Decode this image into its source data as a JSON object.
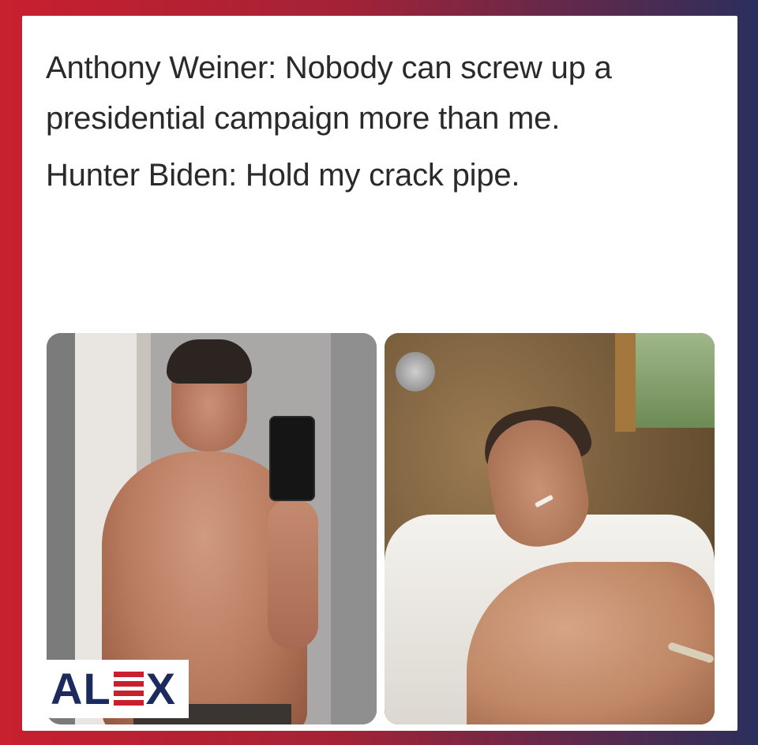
{
  "caption": {
    "line1": "Anthony Weiner: Nobody can screw up a presidential campaign more than me.",
    "line2": "Hunter Biden: Hold my crack pipe."
  },
  "logo": {
    "prefix": "AL",
    "suffix": "X"
  },
  "colors": {
    "frame_left": "#c8202f",
    "frame_right": "#2b2f5c",
    "logo_blue": "#1c2a5e",
    "logo_red": "#c8202f"
  }
}
